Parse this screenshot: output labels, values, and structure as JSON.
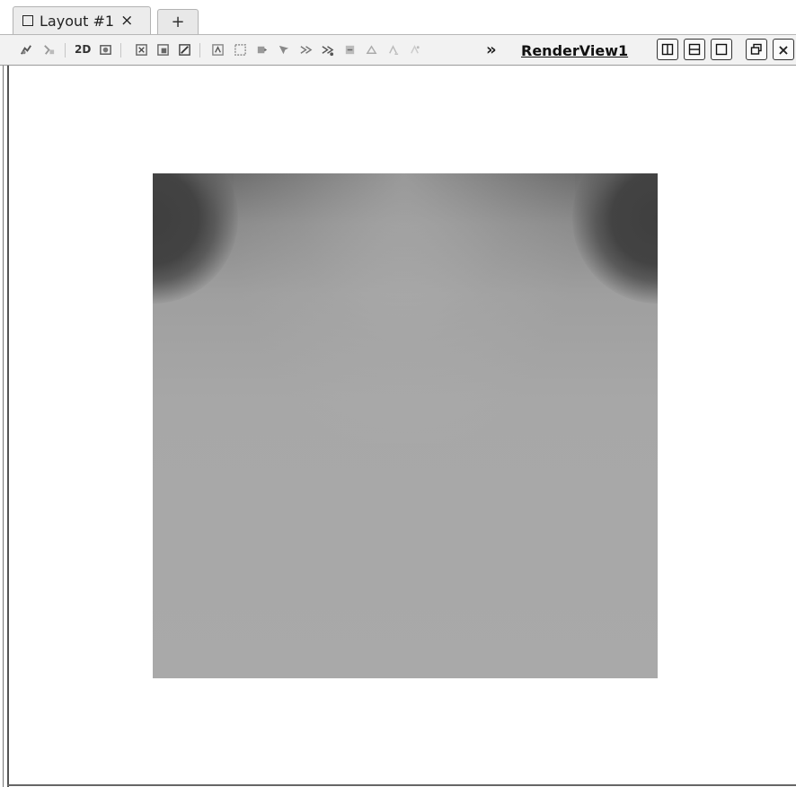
{
  "tabs": {
    "active_label": "Layout #1",
    "close_glyph": "×",
    "add_glyph": "+"
  },
  "toolbar": {
    "label_2d": "2D",
    "more_glyph": "»",
    "view_title": "RenderView1",
    "close_glyph": "×",
    "icons": [
      "reset-camera-icon",
      "zoom-to-data-icon",
      "toggle-2d-3d-icon",
      "capture-screenshot-icon",
      "select-cells-on-icon",
      "select-points-on-icon",
      "select-cells-through-icon",
      "select-points-through-icon",
      "select-cells-polygon-icon",
      "select-points-polygon-icon",
      "interactive-select-cells-icon",
      "interactive-select-points-icon",
      "hover-points-icon",
      "hover-cells-icon",
      "select-block-icon",
      "grow-selection-icon",
      "shrink-selection-icon"
    ],
    "view_buttons": [
      "split-horizontal-icon",
      "split-vertical-icon",
      "maximize-icon",
      "undock-icon",
      "close-view-icon"
    ]
  },
  "render_view": {
    "background_color": "#ffffff",
    "plot_colors": {
      "dark_corner": "#434343",
      "mid_gray": "#a9a9a9",
      "light_gray": "#b4b4b4"
    }
  }
}
